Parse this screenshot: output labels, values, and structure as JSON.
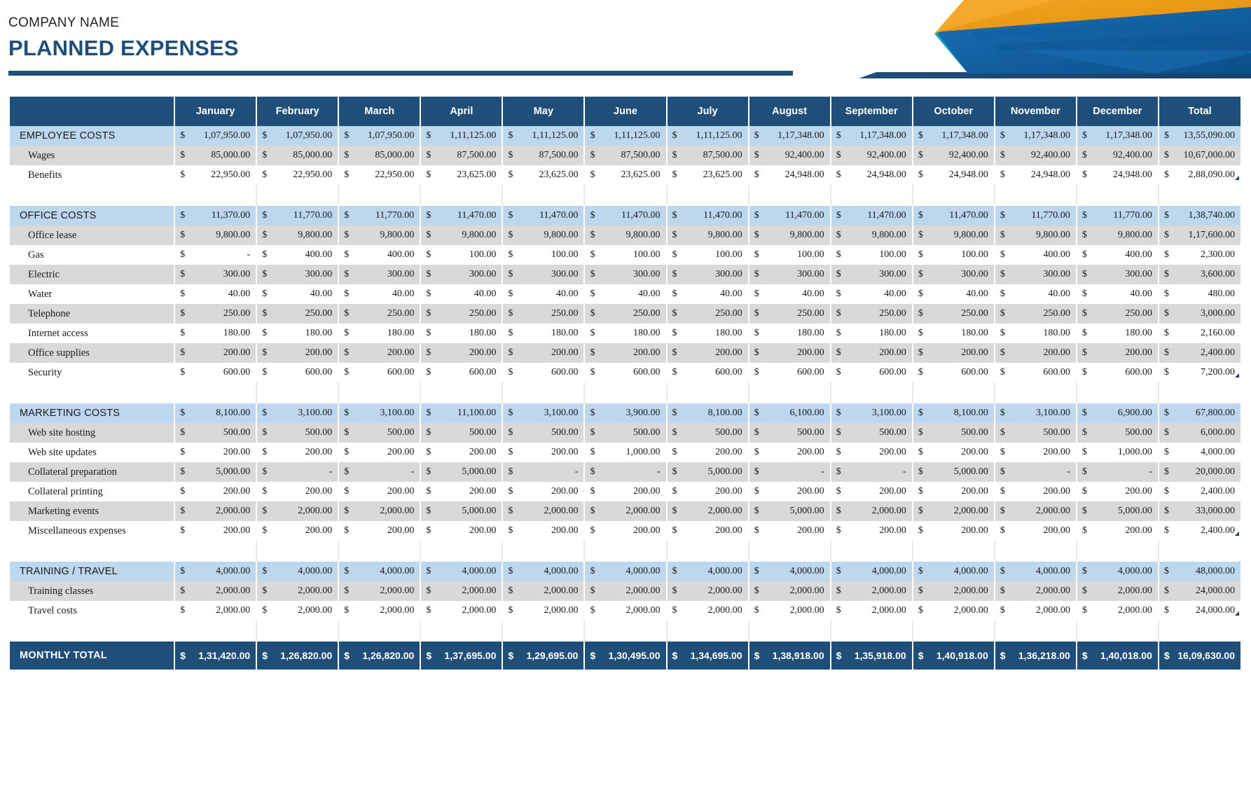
{
  "header": {
    "company_name": "COMPANY NAME",
    "doc_title": "PLANNED EXPENSES",
    "accent_dark_blue": "#1f4e79",
    "accent_mid_blue": "#1261a8",
    "accent_light_blue": "#1b9bd8",
    "accent_orange": "#efa31d"
  },
  "table": {
    "columns": [
      "",
      "January",
      "February",
      "March",
      "April",
      "May",
      "June",
      "July",
      "August",
      "September",
      "October",
      "November",
      "December",
      "Total"
    ],
    "currency_symbol": "$",
    "sections": [
      {
        "name": "EMPLOYEE COSTS",
        "values": [
          "1,07,950.00",
          "1,07,950.00",
          "1,07,950.00",
          "1,11,125.00",
          "1,11,125.00",
          "1,11,125.00",
          "1,11,125.00",
          "1,17,348.00",
          "1,17,348.00",
          "1,17,348.00",
          "1,17,348.00",
          "1,17,348.00",
          "13,55,090.00"
        ],
        "rows": [
          {
            "label": "Wages",
            "values": [
              "85,000.00",
              "85,000.00",
              "85,000.00",
              "87,500.00",
              "87,500.00",
              "87,500.00",
              "87,500.00",
              "92,400.00",
              "92,400.00",
              "92,400.00",
              "92,400.00",
              "92,400.00",
              "10,67,000.00"
            ]
          },
          {
            "label": "Benefits",
            "values": [
              "22,950.00",
              "22,950.00",
              "22,950.00",
              "23,625.00",
              "23,625.00",
              "23,625.00",
              "23,625.00",
              "24,948.00",
              "24,948.00",
              "24,948.00",
              "24,948.00",
              "24,948.00",
              "2,88,090.00"
            ],
            "note": true
          }
        ]
      },
      {
        "name": "OFFICE COSTS",
        "values": [
          "11,370.00",
          "11,770.00",
          "11,770.00",
          "11,470.00",
          "11,470.00",
          "11,470.00",
          "11,470.00",
          "11,470.00",
          "11,470.00",
          "11,470.00",
          "11,770.00",
          "11,770.00",
          "1,38,740.00"
        ],
        "rows": [
          {
            "label": "Office lease",
            "values": [
              "9,800.00",
              "9,800.00",
              "9,800.00",
              "9,800.00",
              "9,800.00",
              "9,800.00",
              "9,800.00",
              "9,800.00",
              "9,800.00",
              "9,800.00",
              "9,800.00",
              "9,800.00",
              "1,17,600.00"
            ]
          },
          {
            "label": "Gas",
            "values": [
              "-",
              "400.00",
              "400.00",
              "100.00",
              "100.00",
              "100.00",
              "100.00",
              "100.00",
              "100.00",
              "100.00",
              "400.00",
              "400.00",
              "2,300.00"
            ]
          },
          {
            "label": "Electric",
            "values": [
              "300.00",
              "300.00",
              "300.00",
              "300.00",
              "300.00",
              "300.00",
              "300.00",
              "300.00",
              "300.00",
              "300.00",
              "300.00",
              "300.00",
              "3,600.00"
            ]
          },
          {
            "label": "Water",
            "values": [
              "40.00",
              "40.00",
              "40.00",
              "40.00",
              "40.00",
              "40.00",
              "40.00",
              "40.00",
              "40.00",
              "40.00",
              "40.00",
              "40.00",
              "480.00"
            ]
          },
          {
            "label": "Telephone",
            "values": [
              "250.00",
              "250.00",
              "250.00",
              "250.00",
              "250.00",
              "250.00",
              "250.00",
              "250.00",
              "250.00",
              "250.00",
              "250.00",
              "250.00",
              "3,000.00"
            ]
          },
          {
            "label": "Internet access",
            "values": [
              "180.00",
              "180.00",
              "180.00",
              "180.00",
              "180.00",
              "180.00",
              "180.00",
              "180.00",
              "180.00",
              "180.00",
              "180.00",
              "180.00",
              "2,160.00"
            ]
          },
          {
            "label": "Office supplies",
            "values": [
              "200.00",
              "200.00",
              "200.00",
              "200.00",
              "200.00",
              "200.00",
              "200.00",
              "200.00",
              "200.00",
              "200.00",
              "200.00",
              "200.00",
              "2,400.00"
            ]
          },
          {
            "label": "Security",
            "values": [
              "600.00",
              "600.00",
              "600.00",
              "600.00",
              "600.00",
              "600.00",
              "600.00",
              "600.00",
              "600.00",
              "600.00",
              "600.00",
              "600.00",
              "7,200.00"
            ],
            "note": true
          }
        ]
      },
      {
        "name": "MARKETING COSTS",
        "values": [
          "8,100.00",
          "3,100.00",
          "3,100.00",
          "11,100.00",
          "3,100.00",
          "3,900.00",
          "8,100.00",
          "6,100.00",
          "3,100.00",
          "8,100.00",
          "3,100.00",
          "6,900.00",
          "67,800.00"
        ],
        "rows": [
          {
            "label": "Web site hosting",
            "values": [
              "500.00",
              "500.00",
              "500.00",
              "500.00",
              "500.00",
              "500.00",
              "500.00",
              "500.00",
              "500.00",
              "500.00",
              "500.00",
              "500.00",
              "6,000.00"
            ]
          },
          {
            "label": "Web site updates",
            "values": [
              "200.00",
              "200.00",
              "200.00",
              "200.00",
              "200.00",
              "1,000.00",
              "200.00",
              "200.00",
              "200.00",
              "200.00",
              "200.00",
              "1,000.00",
              "4,000.00"
            ]
          },
          {
            "label": "Collateral preparation",
            "values": [
              "5,000.00",
              "-",
              "-",
              "5,000.00",
              "-",
              "-",
              "5,000.00",
              "-",
              "-",
              "5,000.00",
              "-",
              "-",
              "20,000.00"
            ]
          },
          {
            "label": "Collateral printing",
            "values": [
              "200.00",
              "200.00",
              "200.00",
              "200.00",
              "200.00",
              "200.00",
              "200.00",
              "200.00",
              "200.00",
              "200.00",
              "200.00",
              "200.00",
              "2,400.00"
            ]
          },
          {
            "label": "Marketing events",
            "values": [
              "2,000.00",
              "2,000.00",
              "2,000.00",
              "5,000.00",
              "2,000.00",
              "2,000.00",
              "2,000.00",
              "5,000.00",
              "2,000.00",
              "2,000.00",
              "2,000.00",
              "5,000.00",
              "33,000.00"
            ]
          },
          {
            "label": "Miscellaneous expenses",
            "values": [
              "200.00",
              "200.00",
              "200.00",
              "200.00",
              "200.00",
              "200.00",
              "200.00",
              "200.00",
              "200.00",
              "200.00",
              "200.00",
              "200.00",
              "2,400.00"
            ],
            "note": true
          }
        ]
      },
      {
        "name": "TRAINING / TRAVEL",
        "values": [
          "4,000.00",
          "4,000.00",
          "4,000.00",
          "4,000.00",
          "4,000.00",
          "4,000.00",
          "4,000.00",
          "4,000.00",
          "4,000.00",
          "4,000.00",
          "4,000.00",
          "4,000.00",
          "48,000.00"
        ],
        "rows": [
          {
            "label": "Training classes",
            "values": [
              "2,000.00",
              "2,000.00",
              "2,000.00",
              "2,000.00",
              "2,000.00",
              "2,000.00",
              "2,000.00",
              "2,000.00",
              "2,000.00",
              "2,000.00",
              "2,000.00",
              "2,000.00",
              "24,000.00"
            ]
          },
          {
            "label": "Travel costs",
            "values": [
              "2,000.00",
              "2,000.00",
              "2,000.00",
              "2,000.00",
              "2,000.00",
              "2,000.00",
              "2,000.00",
              "2,000.00",
              "2,000.00",
              "2,000.00",
              "2,000.00",
              "2,000.00",
              "24,000.00"
            ],
            "note": true
          }
        ]
      }
    ],
    "grand_total": {
      "label": "MONTHLY TOTAL",
      "values": [
        "1,31,420.00",
        "1,26,820.00",
        "1,26,820.00",
        "1,37,695.00",
        "1,29,695.00",
        "1,30,495.00",
        "1,34,695.00",
        "1,38,918.00",
        "1,35,918.00",
        "1,40,918.00",
        "1,36,218.00",
        "1,40,018.00",
        "16,09,630.00"
      ]
    }
  }
}
